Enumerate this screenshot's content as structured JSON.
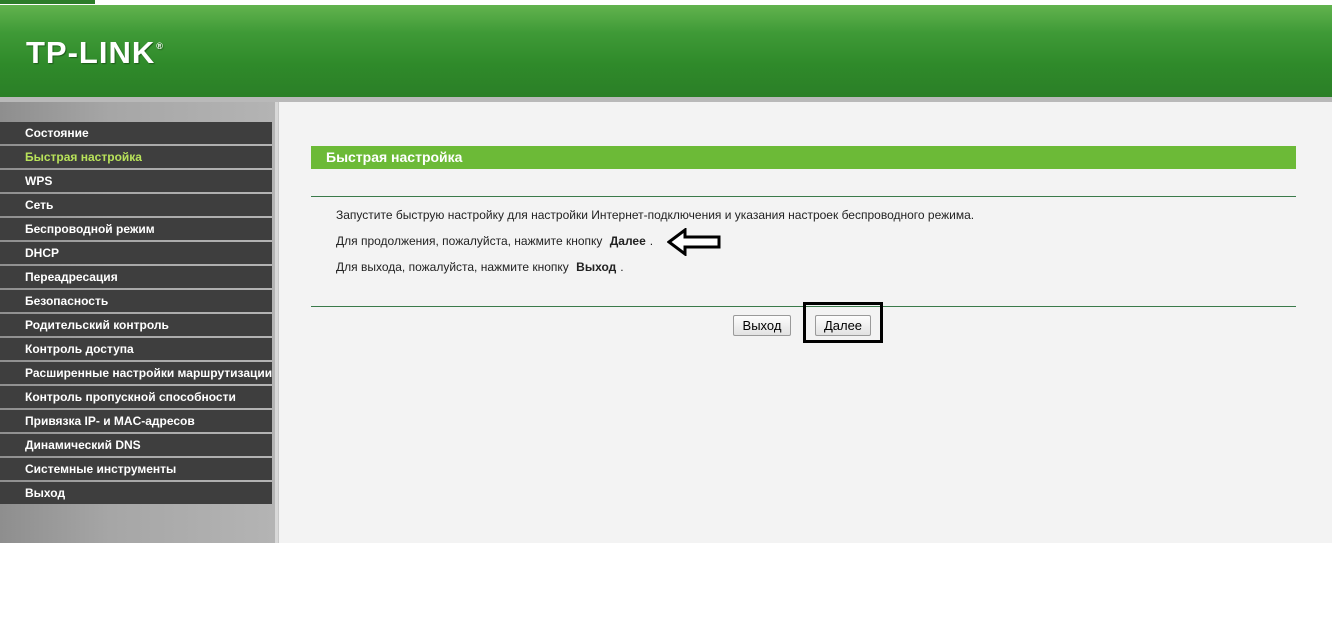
{
  "header": {
    "logo": "TP-LINK",
    "logo_mark": "®"
  },
  "sidebar": {
    "items": [
      {
        "label": "Состояние",
        "active": false
      },
      {
        "label": "Быстрая настройка",
        "active": true
      },
      {
        "label": "WPS",
        "active": false
      },
      {
        "label": "Сеть",
        "active": false
      },
      {
        "label": "Беспроводной режим",
        "active": false
      },
      {
        "label": "DHCP",
        "active": false
      },
      {
        "label": "Переадресация",
        "active": false
      },
      {
        "label": "Безопасность",
        "active": false
      },
      {
        "label": "Родительский контроль",
        "active": false
      },
      {
        "label": "Контроль доступа",
        "active": false
      },
      {
        "label": "Расширенные настройки маршрутизации",
        "active": false
      },
      {
        "label": "Контроль пропускной способности",
        "active": false
      },
      {
        "label": "Привязка IP- и MAC-адресов",
        "active": false
      },
      {
        "label": "Динамический DNS",
        "active": false
      },
      {
        "label": "Системные инструменты",
        "active": false
      },
      {
        "label": "Выход",
        "active": false
      }
    ]
  },
  "main": {
    "title": "Быстрая настройка",
    "line1": "Запустите быструю настройку для настройки Интернет-подключения и указания настроек беспроводного режима.",
    "line2_prefix": "Для продолжения, пожалуйста, нажмите кнопку",
    "line2_bold": "Далее",
    "line3_prefix": "Для выхода, пожалуйста, нажмите кнопку",
    "line3_bold": "Выход",
    "period": ".",
    "exit_button": "Выход",
    "next_button": "Далее"
  },
  "colors": {
    "header_green": "#3f9a37",
    "title_bar_green": "#6cba37",
    "menu_bg": "#3e3e3e",
    "menu_active_text": "#b8e25a"
  }
}
